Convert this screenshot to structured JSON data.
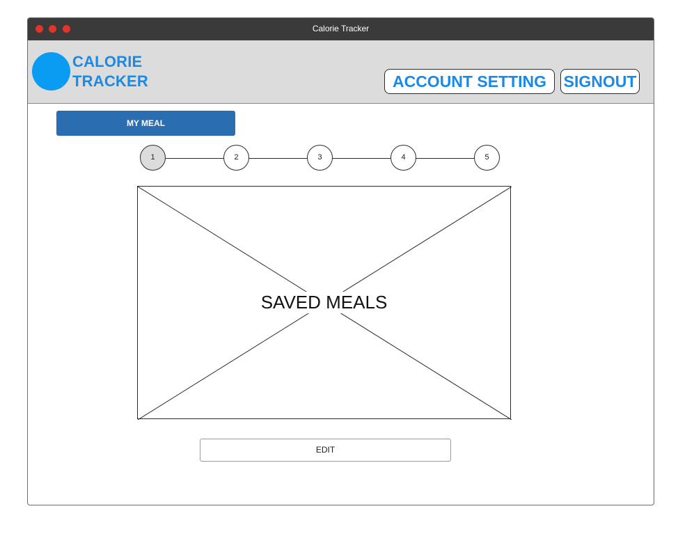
{
  "window": {
    "title": "Calorie Tracker",
    "traffic_light_color": "#e0352b"
  },
  "header": {
    "brand_line1": "CALORIE",
    "brand_line2": "TRACKER",
    "brand_color": "#1a8ae6",
    "logo_color": "#0a9bf2",
    "account_setting_label": "ACCOUNT SETTING",
    "signout_label": "SIGNOUT"
  },
  "main": {
    "my_meal_label": "MY MEAL",
    "my_meal_color": "#2a6db0",
    "steps": [
      "1",
      "2",
      "3",
      "4",
      "5"
    ],
    "active_step": "1",
    "saved_meals_label": "SAVED MEALS",
    "edit_label": "EDIT"
  }
}
